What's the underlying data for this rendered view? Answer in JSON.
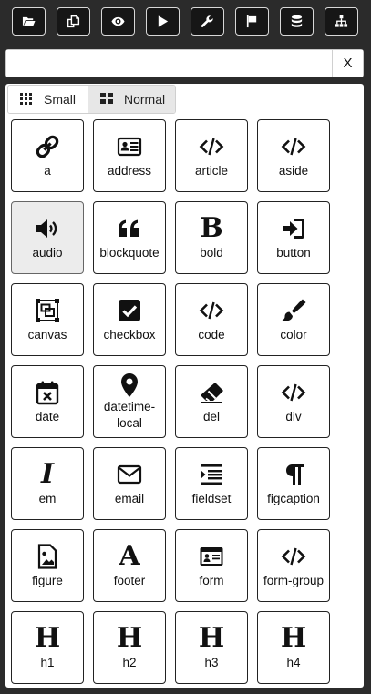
{
  "toolbar": {
    "buttons": [
      {
        "icon": "folder-open-icon"
      },
      {
        "icon": "copy-icon"
      },
      {
        "icon": "eye-icon"
      },
      {
        "icon": "play-icon"
      },
      {
        "icon": "wrench-icon"
      },
      {
        "icon": "flag-icon"
      },
      {
        "icon": "database-icon"
      },
      {
        "icon": "sitemap-icon"
      }
    ]
  },
  "search": {
    "value": "",
    "placeholder": "",
    "clear_label": "X"
  },
  "size_toggle": {
    "small_label": "Small",
    "normal_label": "Normal",
    "selected": "Normal"
  },
  "elements": [
    {
      "label": "a",
      "icon": "link-icon"
    },
    {
      "label": "address",
      "icon": "address-card-icon"
    },
    {
      "label": "article",
      "icon": "code-icon"
    },
    {
      "label": "aside",
      "icon": "code-icon"
    },
    {
      "label": "audio",
      "icon": "volume-up-icon",
      "active": true
    },
    {
      "label": "blockquote",
      "icon": "quote-icon"
    },
    {
      "label": "bold",
      "icon": "bold-icon"
    },
    {
      "label": "button",
      "icon": "sign-in-icon"
    },
    {
      "label": "canvas",
      "icon": "object-group-icon"
    },
    {
      "label": "checkbox",
      "icon": "check-square-icon"
    },
    {
      "label": "code",
      "icon": "code-icon"
    },
    {
      "label": "color",
      "icon": "paint-brush-icon"
    },
    {
      "label": "date",
      "icon": "calendar-times-icon"
    },
    {
      "label": "datetime-local",
      "icon": "map-marker-icon"
    },
    {
      "label": "del",
      "icon": "eraser-icon"
    },
    {
      "label": "div",
      "icon": "code-icon"
    },
    {
      "label": "em",
      "icon": "italic-icon"
    },
    {
      "label": "email",
      "icon": "envelope-icon"
    },
    {
      "label": "fieldset",
      "icon": "indent-icon"
    },
    {
      "label": "figcaption",
      "icon": "paragraph-icon"
    },
    {
      "label": "figure",
      "icon": "file-image-icon"
    },
    {
      "label": "footer",
      "icon": "font-icon"
    },
    {
      "label": "form",
      "icon": "id-card-icon"
    },
    {
      "label": "form-group",
      "icon": "code-icon"
    },
    {
      "label": "h1",
      "icon": "header-icon"
    },
    {
      "label": "h2",
      "icon": "header-icon"
    },
    {
      "label": "h3",
      "icon": "header-icon"
    },
    {
      "label": "h4",
      "icon": "header-icon"
    }
  ]
}
